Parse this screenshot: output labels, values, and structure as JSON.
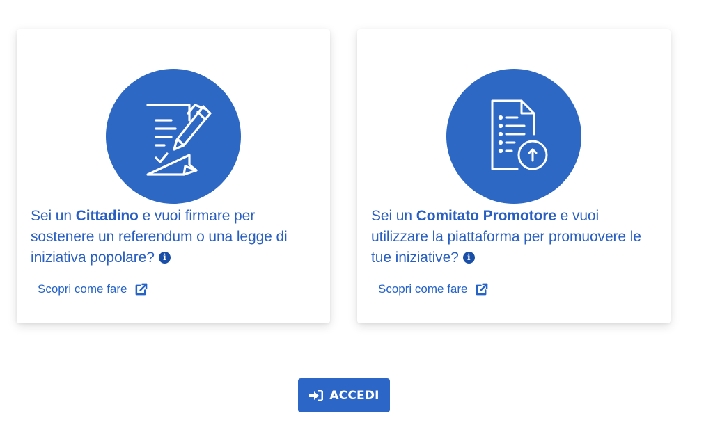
{
  "cards": [
    {
      "icon": "sign-document-icon",
      "headline_prefix": "Sei un ",
      "headline_bold": "Cittadino",
      "headline_suffix": " e vuoi firmare per sostenere un referendum o una legge di iniziativa popolare?",
      "link_label": "Scopri come fare"
    },
    {
      "icon": "document-upload-icon",
      "headline_prefix": "Sei un ",
      "headline_bold": "Comitato Promotore",
      "headline_suffix": " e vuoi utilizzare la piattaforma per promuovere le tue iniziative?",
      "link_label": "Scopri come fare"
    }
  ],
  "login_button": {
    "label": "ACCEDI",
    "icon": "sign-in-icon"
  },
  "colors": {
    "primary": "#2d68c4",
    "text_blue": "#2a5fc2",
    "info_icon": "#1a4fa8",
    "card_bg": "#ffffff"
  }
}
